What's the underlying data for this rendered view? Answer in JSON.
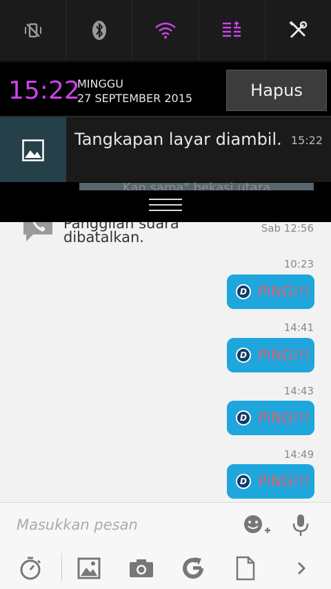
{
  "quick_settings": {
    "tiles": [
      {
        "name": "vibrate-off-icon"
      },
      {
        "name": "bluetooth-icon"
      },
      {
        "name": "wifi-icon"
      },
      {
        "name": "sync-list-icon"
      },
      {
        "name": "settings-tools-icon"
      }
    ],
    "active_color": "#cc44ee"
  },
  "status": {
    "time": "15:22",
    "day": "MINGGU",
    "date": "27 SEPTEMBER 2015",
    "clear_label": "Hapus"
  },
  "notification": {
    "icon": "image-icon",
    "title": "Tangkapan layar diambil.",
    "time": "15:22"
  },
  "peek": {
    "text": "Kan sama\" bekasi utara"
  },
  "chat": {
    "call": {
      "line1": "Panggilan suara",
      "line2": "dibatalkan.",
      "time": "Sab 12:56"
    },
    "messages": [
      {
        "time": "10:23",
        "badge": "D",
        "text": "PING!!!"
      },
      {
        "time": "14:41",
        "badge": "D",
        "text": "PING!!!"
      },
      {
        "time": "14:43",
        "badge": "D",
        "text": "PING!!!"
      },
      {
        "time": "14:49",
        "badge": "D",
        "text": "PING!!!"
      }
    ],
    "bubble_color": "#1ea6dd",
    "ping_color": "#e06070"
  },
  "composer": {
    "placeholder": "Masukkan pesan"
  },
  "toolbar": {
    "items": [
      "timer-icon",
      "gallery-icon",
      "camera-icon",
      "refresh-g-icon",
      "file-icon",
      "chevron-right-icon"
    ]
  }
}
